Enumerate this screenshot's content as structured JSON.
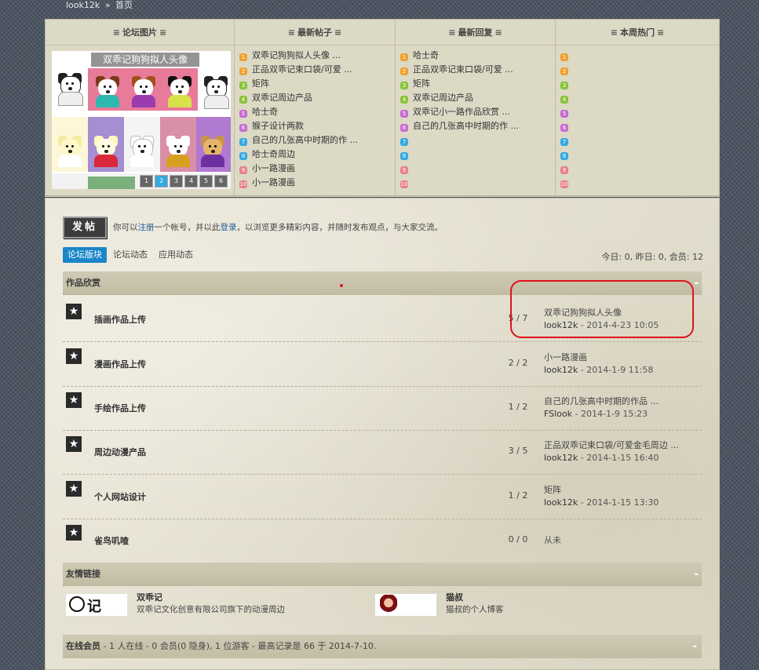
{
  "breadcrumb": {
    "site": "look12k",
    "sep": "»",
    "current": "首页"
  },
  "portal": {
    "columns": [
      {
        "title": "论坛图片"
      },
      {
        "title": "最新帖子"
      },
      {
        "title": "最新回复"
      },
      {
        "title": "本周热门"
      }
    ],
    "gallery": {
      "caption": "双乖记狗狗拟人头像",
      "pages": [
        "1",
        "2",
        "3",
        "4",
        "5",
        "6"
      ],
      "active_page": "2"
    },
    "latest_posts": [
      "双乖记狗狗拟人头像 ...",
      "正品双乖记束口袋/可爱 ...",
      "矩阵",
      "双乖记周边产品",
      "哈士奇",
      "猴子设计两款",
      "自己的几张高中时期的作 ...",
      "哈士奇周边",
      "小一路漫画",
      "小一路漫画"
    ],
    "latest_replies": [
      "哈士奇",
      "正品双乖记束口袋/可爱 ...",
      "矩阵",
      "双乖记周边产品",
      "双乖记小一路作品欣赏 ...",
      "自己的几张高中时期的作 ...",
      "",
      "",
      "",
      ""
    ],
    "weekly_hot": [
      "",
      "",
      "",
      "",
      "",
      "",
      "",
      "",
      "",
      ""
    ],
    "numbers": [
      "1",
      "2",
      "3",
      "4",
      "5",
      "6",
      "7",
      "8",
      "9",
      "10"
    ]
  },
  "post_button": "发帖",
  "intro": {
    "before": "你可以",
    "register": "注册",
    "middle": "一个帐号，并以此",
    "login": "登录",
    "after": "，以浏览更多精彩内容，并随时发布观点，与大家交流。"
  },
  "tabs": [
    {
      "label": "论坛版块",
      "active": true
    },
    {
      "label": "论坛动态",
      "active": false
    },
    {
      "label": "应用动态",
      "active": false
    }
  ],
  "stats": "今日: 0, 昨日: 0, 会员: 12",
  "section_works": {
    "title": "作品欣赏",
    "collapse": "-"
  },
  "forums": [
    {
      "name": "插画作品上传",
      "count": "5 / 7",
      "last_title": "双乖记狗狗拟人头像",
      "last_user": "look12k",
      "last_time": "2014-4-23 10:05"
    },
    {
      "name": "漫画作品上传",
      "count": "2 / 2",
      "last_title": "小一路漫画",
      "last_user": "look12k",
      "last_time": "2014-1-9 11:58"
    },
    {
      "name": "手绘作品上传",
      "count": "1 / 2",
      "last_title": "自己的几张高中时期的作品 ...",
      "last_user": "FSlook",
      "last_time": "2014-1-9 15:23"
    },
    {
      "name": "周边动漫产品",
      "count": "3 / 5",
      "last_title": "正品双乖记束口袋/可爱金毛周边 ...",
      "last_user": "look12k",
      "last_time": "2014-1-15 16:40"
    },
    {
      "name": "个人网站设计",
      "count": "1 / 2",
      "last_title": "矩阵",
      "last_user": "look12k",
      "last_time": "2014-1-15 13:30"
    },
    {
      "name": "雀鸟叽喳",
      "count": "0 / 0",
      "last_title": "从未",
      "last_user": "",
      "last_time": ""
    }
  ],
  "section_links": {
    "title": "友情链接",
    "collapse": "-"
  },
  "links": [
    {
      "logo_text": "记",
      "name": "双乖记",
      "desc": "双乖记文化创意有限公司旗下的动漫周边"
    },
    {
      "logo_text": "",
      "name": "猫叔",
      "desc": "猫叔的个人博客"
    }
  ],
  "online": {
    "label": "在线会员",
    "text": " - 1 人在线 - 0 会员(0 隐身), 1 位游客 - 最高记录是 66 于 2014-7-10.",
    "collapse": "-"
  }
}
